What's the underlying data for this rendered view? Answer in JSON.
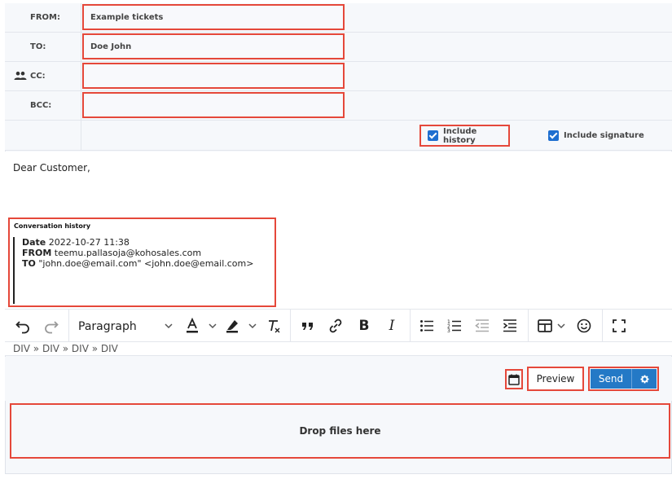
{
  "fields": {
    "from": {
      "label": "FROM:",
      "value": "Example tickets"
    },
    "to": {
      "label": "TO:",
      "value": "Doe John"
    },
    "cc": {
      "label": "CC:",
      "value": "",
      "icon": "people-icon"
    },
    "bcc": {
      "label": "BCC:",
      "value": ""
    }
  },
  "options": {
    "include_history": {
      "label": "Include history",
      "checked": true
    },
    "include_signature": {
      "label": "Include signature",
      "checked": true
    }
  },
  "editor": {
    "greeting": "Dear Customer,",
    "history": {
      "title": "Conversation history",
      "lines": [
        {
          "key": "Date",
          "value": "2022-10-27 11:38"
        },
        {
          "key": "FROM",
          "value": "teemu.pallasoja@kohosales.com"
        },
        {
          "key": "TO",
          "value": "\"john.doe@email.com\" <john.doe@email.com>"
        }
      ]
    }
  },
  "toolbar": {
    "block_format": "Paragraph",
    "icons": [
      "undo-icon",
      "redo-icon",
      "text-color-icon",
      "highlight-icon",
      "clear-format-icon",
      "blockquote-icon",
      "link-icon",
      "bold-icon",
      "italic-icon",
      "bullet-list-icon",
      "numbered-list-icon",
      "outdent-icon",
      "indent-icon",
      "table-icon",
      "emoji-icon",
      "fullscreen-icon"
    ]
  },
  "statusbar": {
    "path": "DIV » DIV » DIV » DIV"
  },
  "actions": {
    "schedule_icon": "calendar-icon",
    "preview_label": "Preview",
    "send_label": "Send",
    "send_options_icon": "gear-icon"
  },
  "dropzone": {
    "label": "Drop files here"
  },
  "colors": {
    "accent": "#2479c6",
    "highlight_border": "#e5483a",
    "checkbox": "#1f6fd0"
  }
}
